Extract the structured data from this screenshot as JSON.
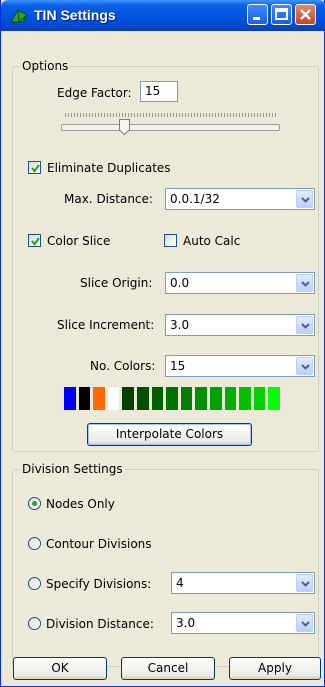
{
  "window": {
    "title": "TIN Settings"
  },
  "options": {
    "legend": "Options",
    "edge_factor_label": "Edge Factor:",
    "edge_factor_value": "15",
    "edge_factor_slider_fraction": 0.28,
    "eliminate_duplicates_label": "Eliminate Duplicates",
    "eliminate_duplicates_checked": true,
    "max_distance_label": "Max. Distance:",
    "max_distance_value": "0.0.1/32",
    "color_slice_label": "Color Slice",
    "color_slice_checked": true,
    "auto_calc_label": "Auto Calc",
    "auto_calc_checked": false,
    "slice_origin_label": "Slice Origin:",
    "slice_origin_value": "0.0",
    "slice_increment_label": "Slice Increment:",
    "slice_increment_value": "3.0",
    "no_colors_label": "No. Colors:",
    "no_colors_value": "15",
    "color_swatches": [
      "#0000ff",
      "#000000",
      "#ff6a00",
      "#ffffff",
      "#004000",
      "#005000",
      "#006000",
      "#007000",
      "#008000",
      "#009000",
      "#00a000",
      "#00b000",
      "#00c000",
      "#00d000",
      "#00ff00"
    ],
    "interpolate_button": "Interpolate Colors"
  },
  "division": {
    "legend": "Division Settings",
    "nodes_only_label": "Nodes Only",
    "contour_divisions_label": "Contour Divisions",
    "specify_divisions_label": "Specify Divisions:",
    "specify_divisions_value": "4",
    "division_distance_label": "Division Distance:",
    "division_distance_value": "3.0",
    "selected": "Nodes Only"
  },
  "buttons": {
    "ok": "OK",
    "cancel": "Cancel",
    "apply": "Apply"
  }
}
